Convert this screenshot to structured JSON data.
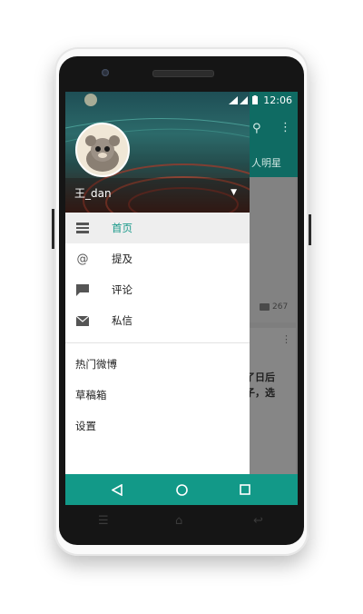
{
  "status_bar": {
    "time": "12:06"
  },
  "profile": {
    "username": "王_dan"
  },
  "menu": {
    "items": [
      {
        "label": "首页",
        "icon": "home-list-icon"
      },
      {
        "label": "提及",
        "icon": "at-icon"
      },
      {
        "label": "评论",
        "icon": "comment-icon"
      },
      {
        "label": "私信",
        "icon": "mail-icon"
      }
    ],
    "secondary": [
      {
        "label": "热门微博"
      },
      {
        "label": "草稿箱"
      },
      {
        "label": "设置"
      }
    ]
  },
  "background": {
    "tab_label": "人明星",
    "comment_count": "267",
    "text_line_1": "了日后",
    "text_line_2": "子，选"
  },
  "colors": {
    "accent": "#129988",
    "active_text": "#1b9a8b",
    "toolbar": "#0f6b63"
  }
}
